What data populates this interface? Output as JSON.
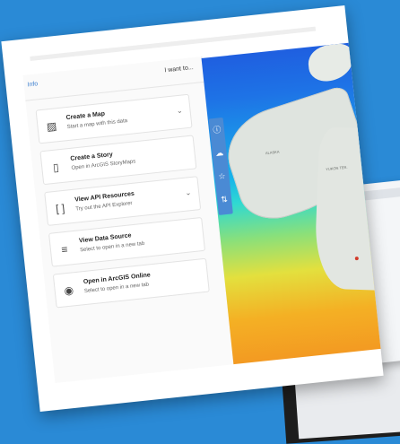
{
  "panel": {
    "info_tab": "Info",
    "want_to": "I want to...",
    "items": [
      {
        "title": "Create a Map",
        "subtitle": "Start a map with this data",
        "icon": "map-add-icon",
        "has_chevron": true
      },
      {
        "title": "Create a Story",
        "subtitle": "Open in ArcGIS StoryMaps",
        "icon": "storymap-icon",
        "has_chevron": false
      },
      {
        "title": "View API Resources",
        "subtitle": "Try out the API Explorer",
        "icon": "api-braces-icon",
        "has_chevron": true
      },
      {
        "title": "View Data Source",
        "subtitle": "Select to open in a new tab",
        "icon": "data-source-icon",
        "has_chevron": false
      },
      {
        "title": "Open in ArcGIS Online",
        "subtitle": "Select to open in a new tab",
        "icon": "view-eye-icon",
        "has_chevron": false
      }
    ]
  },
  "toolbar": {
    "icons": [
      "info-icon",
      "cloud-download-icon",
      "star-icon",
      "swap-icon"
    ]
  },
  "map": {
    "labels": [
      "YUKON TER.",
      "ALASKA"
    ]
  },
  "colors": {
    "background": "#2a8ad6",
    "accent": "#4a8ad4"
  }
}
